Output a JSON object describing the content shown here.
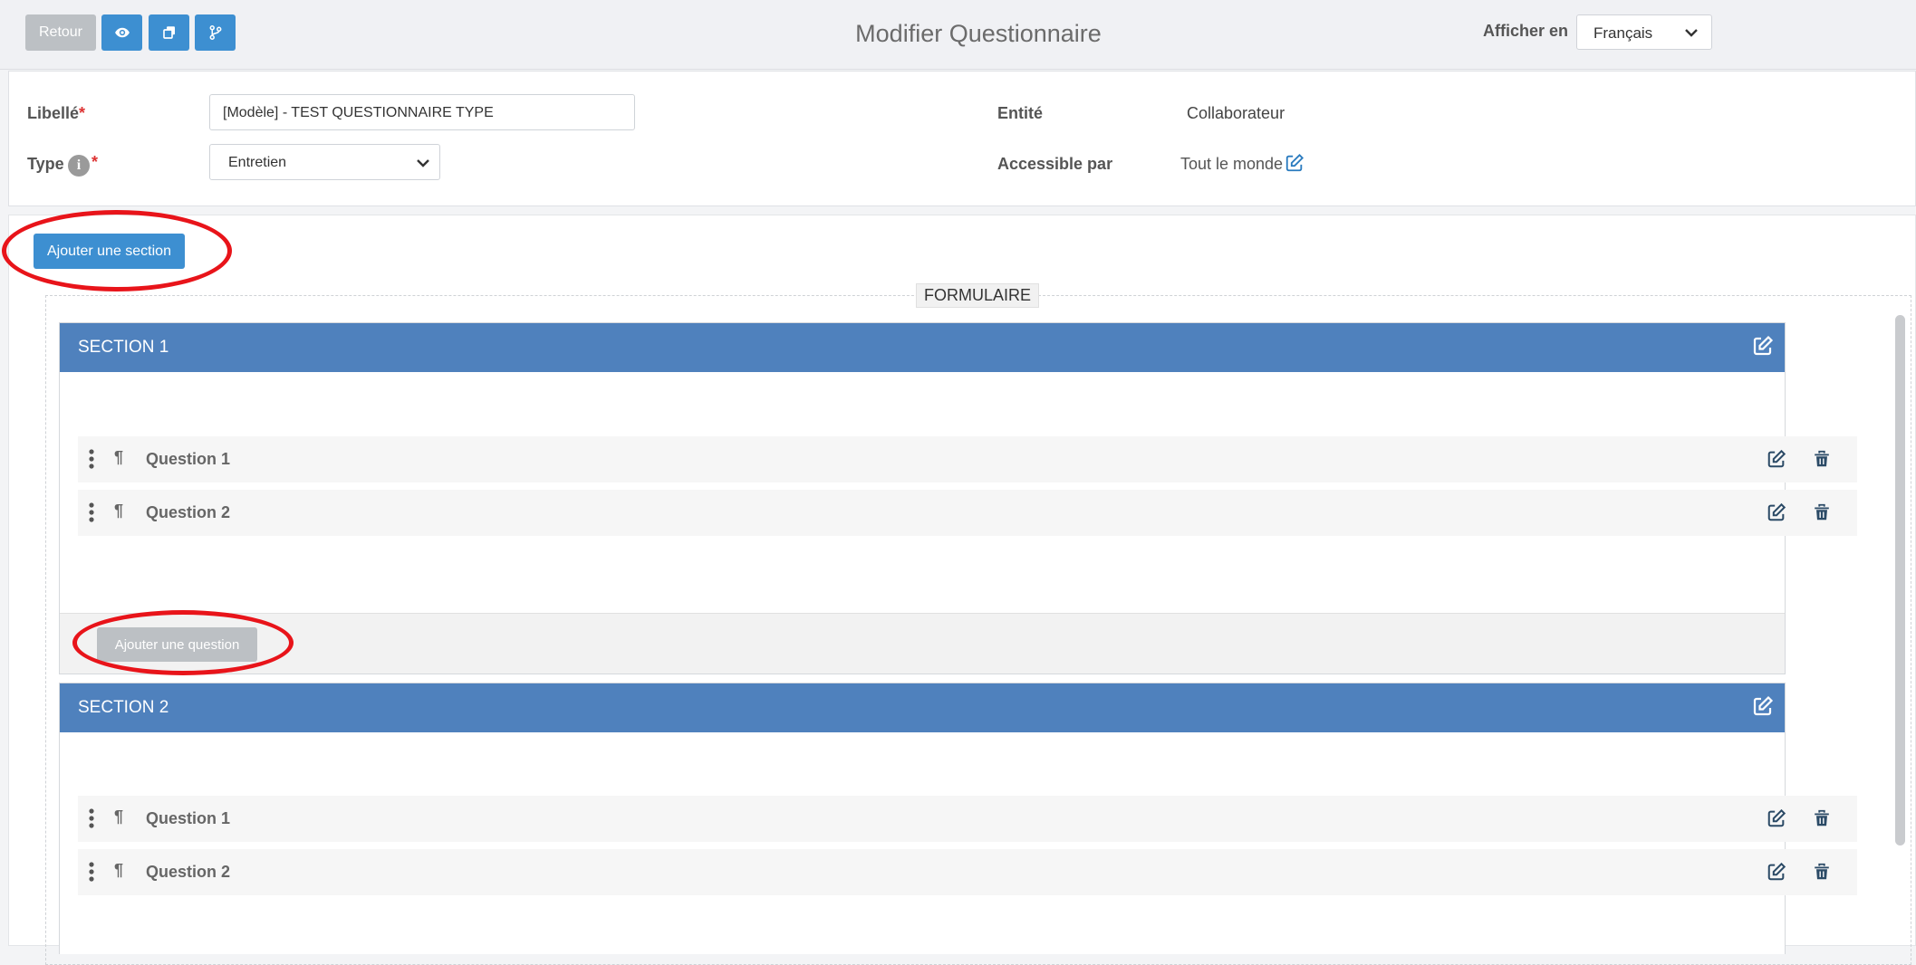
{
  "toolbar": {
    "back_label": "Retour",
    "preview_icon": "eye-icon",
    "duplicate_icon": "copy-icon",
    "branch_icon": "branch-icon"
  },
  "header": {
    "title": "Modifier Questionnaire",
    "display_in_label": "Afficher en",
    "language_value": "Français"
  },
  "form": {
    "label_field": "Libellé",
    "label_value": "[Modèle] - TEST QUESTIONNAIRE TYPE",
    "type_field": "Type",
    "type_value": "Entretien",
    "required_mark": "*",
    "entity_field": "Entité",
    "entity_value": "Collaborateur",
    "accessible_field": "Accessible par",
    "accessible_value": "Tout le monde"
  },
  "add_section_label": "Ajouter une section",
  "formulaire_legend": "FORMULAIRE",
  "sections": [
    {
      "title": "SECTION 1",
      "questions": [
        {
          "label": "Question 1"
        },
        {
          "label": "Question 2"
        }
      ],
      "add_question_label": "Ajouter une question"
    },
    {
      "title": "SECTION 2",
      "questions": [
        {
          "label": "Question 1"
        },
        {
          "label": "Question 2"
        }
      ]
    }
  ],
  "colors": {
    "primary_blue": "#3d8fd1",
    "section_header": "#4f81bd",
    "annotation_red": "#e8141a",
    "disabled_grey": "#bcc0c4"
  }
}
